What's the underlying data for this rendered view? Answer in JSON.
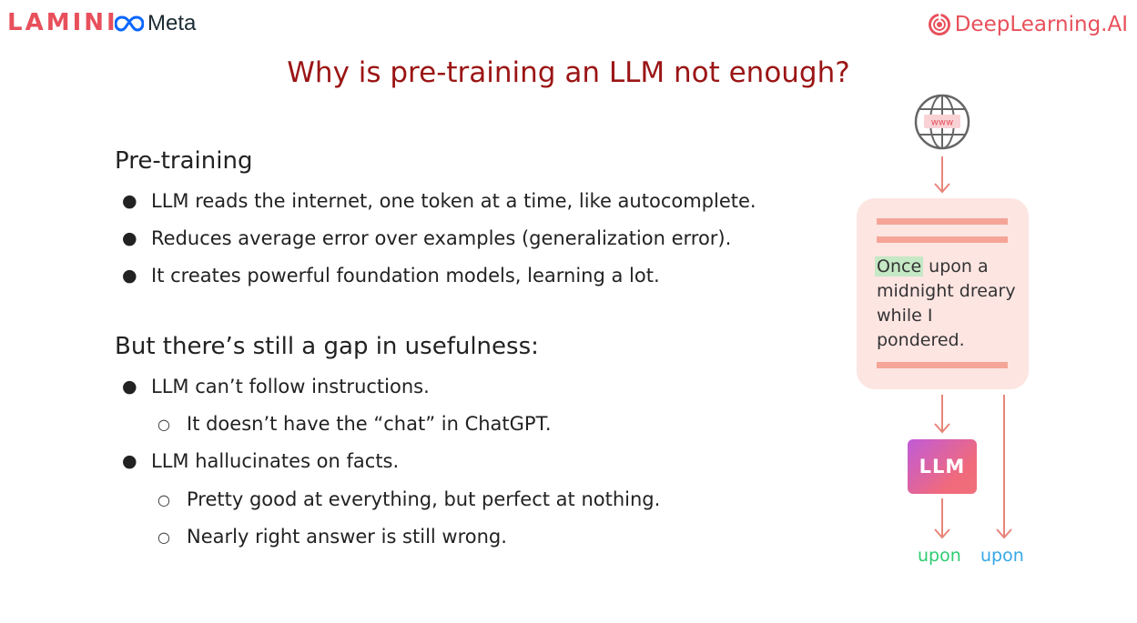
{
  "header": {
    "lamini_logo": "LAMINI",
    "meta_logo": "Meta",
    "deeplearning_logo": "DeepLearning.AI"
  },
  "title": "Why is pre-training an LLM not enough?",
  "section1": {
    "heading": "Pre-training",
    "bullets": [
      "LLM reads the internet, one token at a time, like autocomplete.",
      "Reduces average error over examples (generalization error).",
      "It creates powerful foundation models, learning a lot."
    ]
  },
  "section2": {
    "heading": "But there’s still a gap in usefulness:",
    "bullet1": "LLM can’t follow instructions.",
    "bullet1_sub": "It doesn’t have the “chat” in ChatGPT.",
    "bullet2": "LLM hallucinates on facts.",
    "bullet2_subs": [
      "Pretty good at everything, but perfect at nothing.",
      "Nearly right answer is still wrong."
    ]
  },
  "diagram": {
    "globe_label": "www",
    "doc_highlight": "Once",
    "doc_rest": " upon a midnight dreary while I pondered.",
    "llm_label": "LLM",
    "predicted_token": "upon",
    "actual_token": "upon",
    "colors": {
      "predicted": "#2ecc71",
      "actual": "#36a8e6",
      "arrow": "#e8857a"
    }
  }
}
